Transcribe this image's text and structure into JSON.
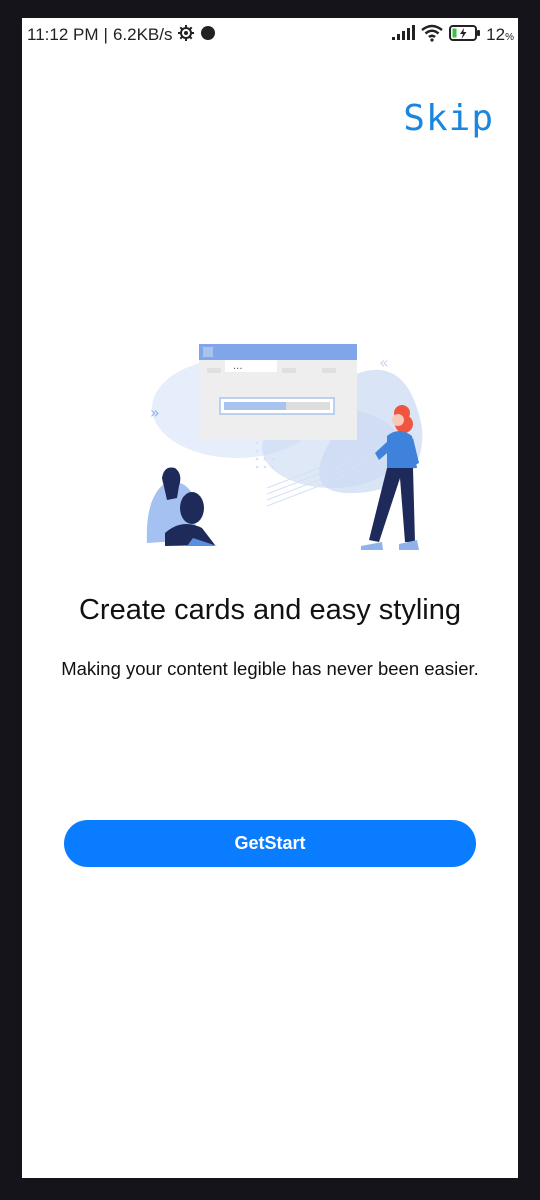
{
  "status_bar": {
    "time": "11:12 PM",
    "separator": "|",
    "network_speed": "6.2KB/s",
    "battery_level": "12",
    "battery_unit": "%"
  },
  "onboarding": {
    "skip_label": "Skip",
    "title": "Create cards and easy styling",
    "subtitle": "Making your content legible has never been easier.",
    "button_label": "GetStart",
    "illustration_dots": "..."
  },
  "colors": {
    "accent": "#0a7cff",
    "skip_text": "#1a86e0",
    "frame": "#15141a"
  },
  "icons": [
    "gear-icon",
    "dot-icon",
    "signal-icon",
    "wifi-icon",
    "battery-charging-icon"
  ]
}
